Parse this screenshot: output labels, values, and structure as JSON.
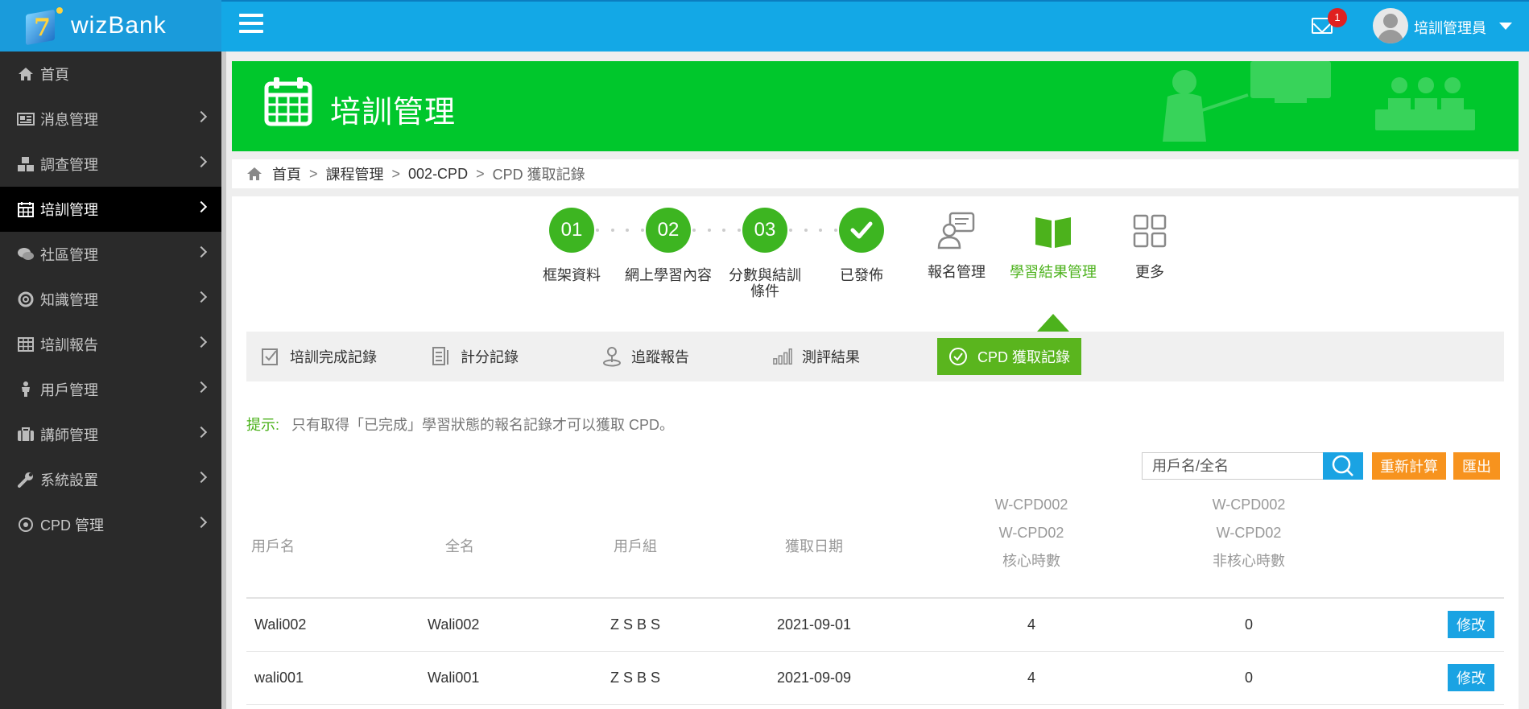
{
  "app": {
    "logo_text": "wizBank"
  },
  "sidebar": {
    "items": [
      {
        "label": "首頁",
        "icon": "home-icon"
      },
      {
        "label": "消息管理",
        "icon": "newspaper-icon"
      },
      {
        "label": "調查管理",
        "icon": "cubes-icon"
      },
      {
        "label": "培訓管理",
        "icon": "calendar-icon",
        "active": true
      },
      {
        "label": "社區管理",
        "icon": "comments-icon"
      },
      {
        "label": "知識管理",
        "icon": "lifebuoy-icon"
      },
      {
        "label": "培訓報告",
        "icon": "table-icon"
      },
      {
        "label": "用戶管理",
        "icon": "user-icon"
      },
      {
        "label": "講師管理",
        "icon": "briefcase-icon"
      },
      {
        "label": "系統設置",
        "icon": "wrench-icon"
      },
      {
        "label": "CPD 管理",
        "icon": "compass-icon"
      }
    ]
  },
  "topbar": {
    "mail_count": "1",
    "user_name": "培訓管理員"
  },
  "banner": {
    "title": "培訓管理"
  },
  "breadcrumb": {
    "items": [
      "首頁",
      "課程管理",
      "002-CPD"
    ],
    "current": "CPD 獲取記錄",
    "separator": ">"
  },
  "steps": [
    {
      "num": "01",
      "label": "框架資料"
    },
    {
      "num": "02",
      "label": "網上學習內容"
    },
    {
      "num": "03",
      "label": "分數與結訓條件"
    },
    {
      "num": "",
      "label": "已發佈"
    },
    {
      "num": "",
      "label": "報名管理"
    },
    {
      "num": "",
      "label": "學習結果管理"
    },
    {
      "num": "",
      "label": "更多"
    }
  ],
  "tabs": [
    {
      "label": "培訓完成記錄"
    },
    {
      "label": "計分記錄"
    },
    {
      "label": "追蹤報告"
    },
    {
      "label": "測評結果"
    },
    {
      "label": "CPD 獲取記錄",
      "active": true
    }
  ],
  "hint": {
    "prefix": "提示:",
    "text": "只有取得「已完成」學習狀態的報名記錄才可以獲取 CPD。"
  },
  "search": {
    "placeholder": "用戶名/全名",
    "value": ""
  },
  "buttons": {
    "recalc": "重新計算",
    "export": "匯出",
    "edit": "修改"
  },
  "table": {
    "headers": {
      "username": "用戶名",
      "fullname": "全名",
      "group": "用戶組",
      "date": "獲取日期",
      "core": [
        "W-CPD002",
        "W-CPD02",
        "核心時數"
      ],
      "noncore": [
        "W-CPD002",
        "W-CPD02",
        "非核心時數"
      ]
    },
    "rows": [
      {
        "username": "Wali002",
        "fullname": "Wali002",
        "group": "Z S B S",
        "date": "2021-09-01",
        "core": "4",
        "noncore": "0"
      },
      {
        "username": "wali001",
        "fullname": "Wali001",
        "group": "Z S B S",
        "date": "2021-09-09",
        "core": "4",
        "noncore": "0"
      }
    ]
  },
  "colors": {
    "accent_green": "#00c72c",
    "step_green": "#3db521",
    "topbar_blue": "#13a8e6",
    "orange": "#f7931e"
  }
}
